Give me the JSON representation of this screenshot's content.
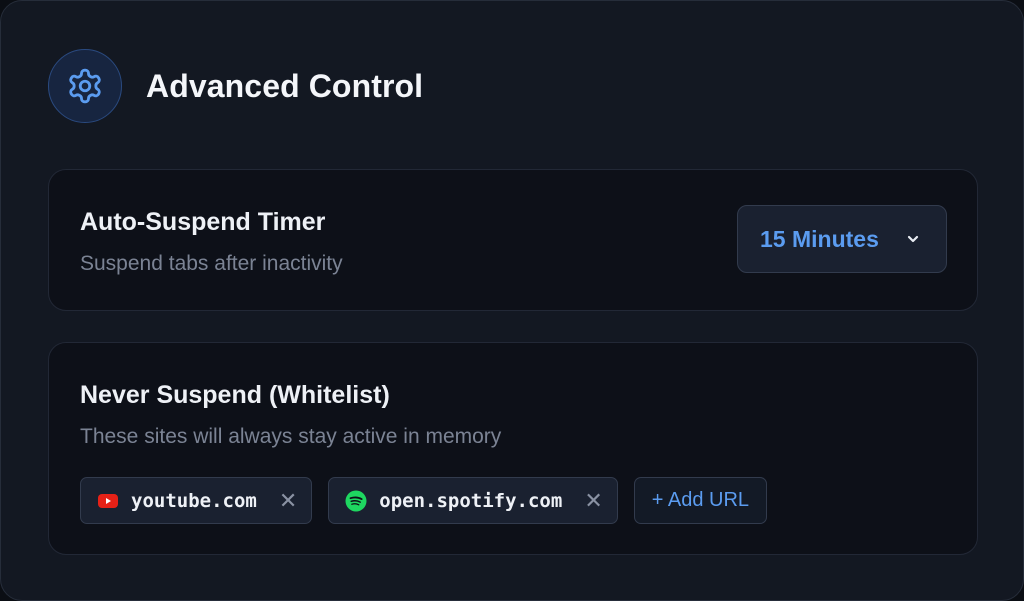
{
  "header": {
    "title": "Advanced Control",
    "icon": "gear-icon",
    "accent_color": "#5b9cf0"
  },
  "timer": {
    "title": "Auto-Suspend Timer",
    "subtitle": "Suspend tabs after inactivity",
    "selected_value": "15 Minutes"
  },
  "whitelist": {
    "title": "Never Suspend (Whitelist)",
    "subtitle": "These sites will always stay active in memory",
    "sites": [
      {
        "label": "youtube.com",
        "icon": "youtube-icon",
        "icon_color": "#e62117"
      },
      {
        "label": "open.spotify.com",
        "icon": "spotify-icon",
        "icon_color": "#1ed760"
      }
    ],
    "remove_glyph": "✕",
    "add_label": "+ Add URL"
  }
}
